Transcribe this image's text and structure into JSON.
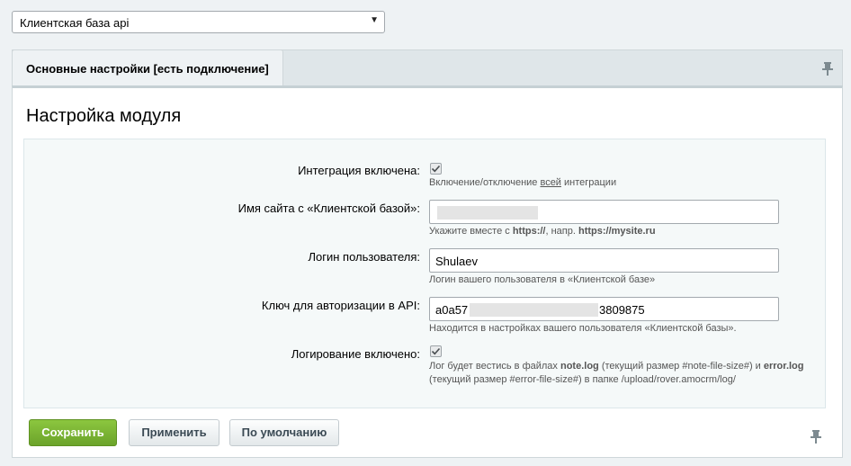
{
  "site_select": {
    "value": "Клиентская база api"
  },
  "tabs": [
    {
      "label": "Основные настройки [есть подключение]"
    }
  ],
  "panel": {
    "title": "Настройка модуля"
  },
  "fields": {
    "integration": {
      "label": "Интеграция включена:",
      "checked": true,
      "hint_before": "Включение/отключение ",
      "hint_underlined": "всей",
      "hint_after": " интеграции"
    },
    "site_name": {
      "label": "Имя сайта с «Клиентской базой»:",
      "value": "",
      "hint_before": "Укажите вместе с ",
      "hint_bold1": "https://",
      "hint_middle": ", напр. ",
      "hint_bold2": "https://mysite.ru"
    },
    "login": {
      "label": "Логин пользователя:",
      "value": "Shulaev",
      "hint": "Логин вашего пользователя в «Клиентской базе»"
    },
    "api_key": {
      "label": "Ключ для авторизации в API:",
      "value_start": "a0a57",
      "value_end": "3809875",
      "hint": "Находится в настройках вашего пользователя «Клиентской базы»."
    },
    "logging": {
      "label": "Логирование включено:",
      "checked": true,
      "hint_p1": "Лог будет вестись в файлах ",
      "hint_b1": "note.log",
      "hint_p2": " (текущий размер #note-file-size#) и ",
      "hint_b2": "error.log",
      "hint_line2": "(текущий размер #error-file-size#) в папке /upload/rover.amocrm/log/"
    }
  },
  "buttons": {
    "save": "Сохранить",
    "apply": "Применить",
    "default": "По умолчанию"
  },
  "colors": {
    "save_button": "#7cb733",
    "background": "#eef2f4",
    "form_background": "#f5f9f9"
  },
  "icons": {
    "pin": "pin-icon",
    "checkmark": "checkmark-icon",
    "dropdown": "triangle-down-icon"
  }
}
